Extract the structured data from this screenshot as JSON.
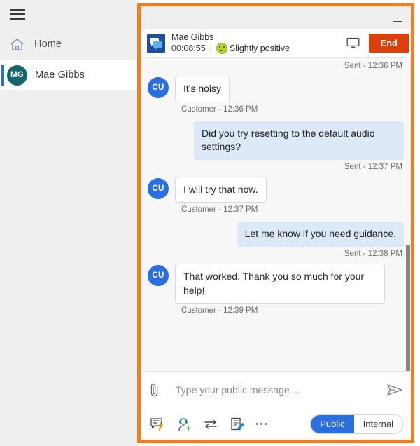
{
  "sidebar": {
    "menu_icon": "hamburger-icon",
    "items": [
      {
        "label": "Home",
        "icon": "home-icon"
      },
      {
        "label": "Mae Gibbs",
        "icon": "avatar",
        "initials": "MG",
        "selected": true
      }
    ]
  },
  "panel": {
    "minimize_label": "Minimize",
    "header": {
      "chat_icon": "chat-bubbles-icon",
      "name": "Mae Gibbs",
      "timer": "00:08:55",
      "separator": "|",
      "sentiment_icon": "smiley-slightly-positive-icon",
      "sentiment": "Slightly positive",
      "monitor_icon": "monitor-icon",
      "end_label": "End",
      "end_color": "#d9400b"
    },
    "messages": [
      {
        "id": "m1",
        "direction": "outbound",
        "stamp": "Sent - 12:36 PM",
        "text": ""
      },
      {
        "id": "m2",
        "direction": "inbound",
        "avatar": "CU",
        "text": "It's noisy",
        "stamp": "Customer - 12:36 PM"
      },
      {
        "id": "m3",
        "direction": "outbound",
        "text": "Did you try resetting to the default audio settings?",
        "stamp": "Sent - 12:37 PM"
      },
      {
        "id": "m4",
        "direction": "inbound",
        "avatar": "CU",
        "text": "I will try that now.",
        "stamp": "Customer - 12:37 PM"
      },
      {
        "id": "m5",
        "direction": "outbound",
        "text": "Let me know if you need guidance.",
        "stamp": "Sent - 12:38 PM"
      },
      {
        "id": "m6",
        "direction": "inbound",
        "avatar": "CU",
        "text": "That worked. Thank you so much for your help!",
        "stamp": "Customer - 12:39 PM"
      }
    ],
    "composer": {
      "attach_icon": "paperclip-icon",
      "placeholder": "Type your public message ...",
      "value": "",
      "send_icon": "send-paper-plane-icon",
      "tools": [
        {
          "name": "quick-response-icon"
        },
        {
          "name": "add-agent-icon"
        },
        {
          "name": "transfer-icon"
        },
        {
          "name": "notes-icon"
        },
        {
          "name": "more-options-icon"
        }
      ],
      "visibility": {
        "active": "Public",
        "inactive": "Internal",
        "active_color": "#2a6fdd"
      }
    }
  },
  "theme": {
    "highlight_border": "#f47b20",
    "customer_avatar": "#2a6fdd",
    "agent_avatar": "#13666b",
    "outbound_bubble": "#dde8f9"
  }
}
